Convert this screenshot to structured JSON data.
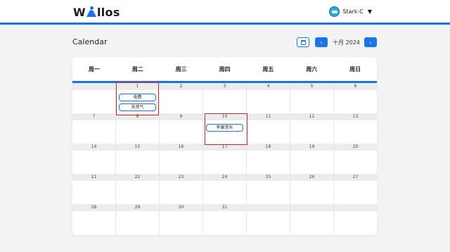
{
  "header": {
    "logo_w": "W",
    "logo_rest": "llos",
    "username": "Stark-C",
    "caret": "▼",
    "accent": "#1a73e8"
  },
  "page": {
    "title": "Calendar",
    "month_label": "十月 2024",
    "prev_icon": "‹",
    "next_icon": "›"
  },
  "calendar": {
    "weekdays": [
      "周一",
      "周二",
      "周三",
      "周四",
      "周五",
      "周六",
      "周日"
    ],
    "weeks": [
      [
        {
          "day": ""
        },
        {
          "day": "1",
          "events": [
            "电费",
            "天然气"
          ]
        },
        {
          "day": "2"
        },
        {
          "day": "3"
        },
        {
          "day": "4"
        },
        {
          "day": "5"
        },
        {
          "day": "6"
        }
      ],
      [
        {
          "day": "7"
        },
        {
          "day": "8"
        },
        {
          "day": "9"
        },
        {
          "day": "10",
          "events": [
            "苹果音乐"
          ]
        },
        {
          "day": "11"
        },
        {
          "day": "12"
        },
        {
          "day": "13"
        }
      ],
      [
        {
          "day": "14"
        },
        {
          "day": "15"
        },
        {
          "day": "16"
        },
        {
          "day": "17"
        },
        {
          "day": "18"
        },
        {
          "day": "19"
        },
        {
          "day": "20"
        }
      ],
      [
        {
          "day": "21"
        },
        {
          "day": "22"
        },
        {
          "day": "23"
        },
        {
          "day": "24"
        },
        {
          "day": "25"
        },
        {
          "day": "26"
        },
        {
          "day": "27"
        }
      ],
      [
        {
          "day": "28"
        },
        {
          "day": "29"
        },
        {
          "day": "30"
        },
        {
          "day": "31"
        },
        {
          "day": ""
        },
        {
          "day": ""
        },
        {
          "day": ""
        }
      ]
    ]
  }
}
